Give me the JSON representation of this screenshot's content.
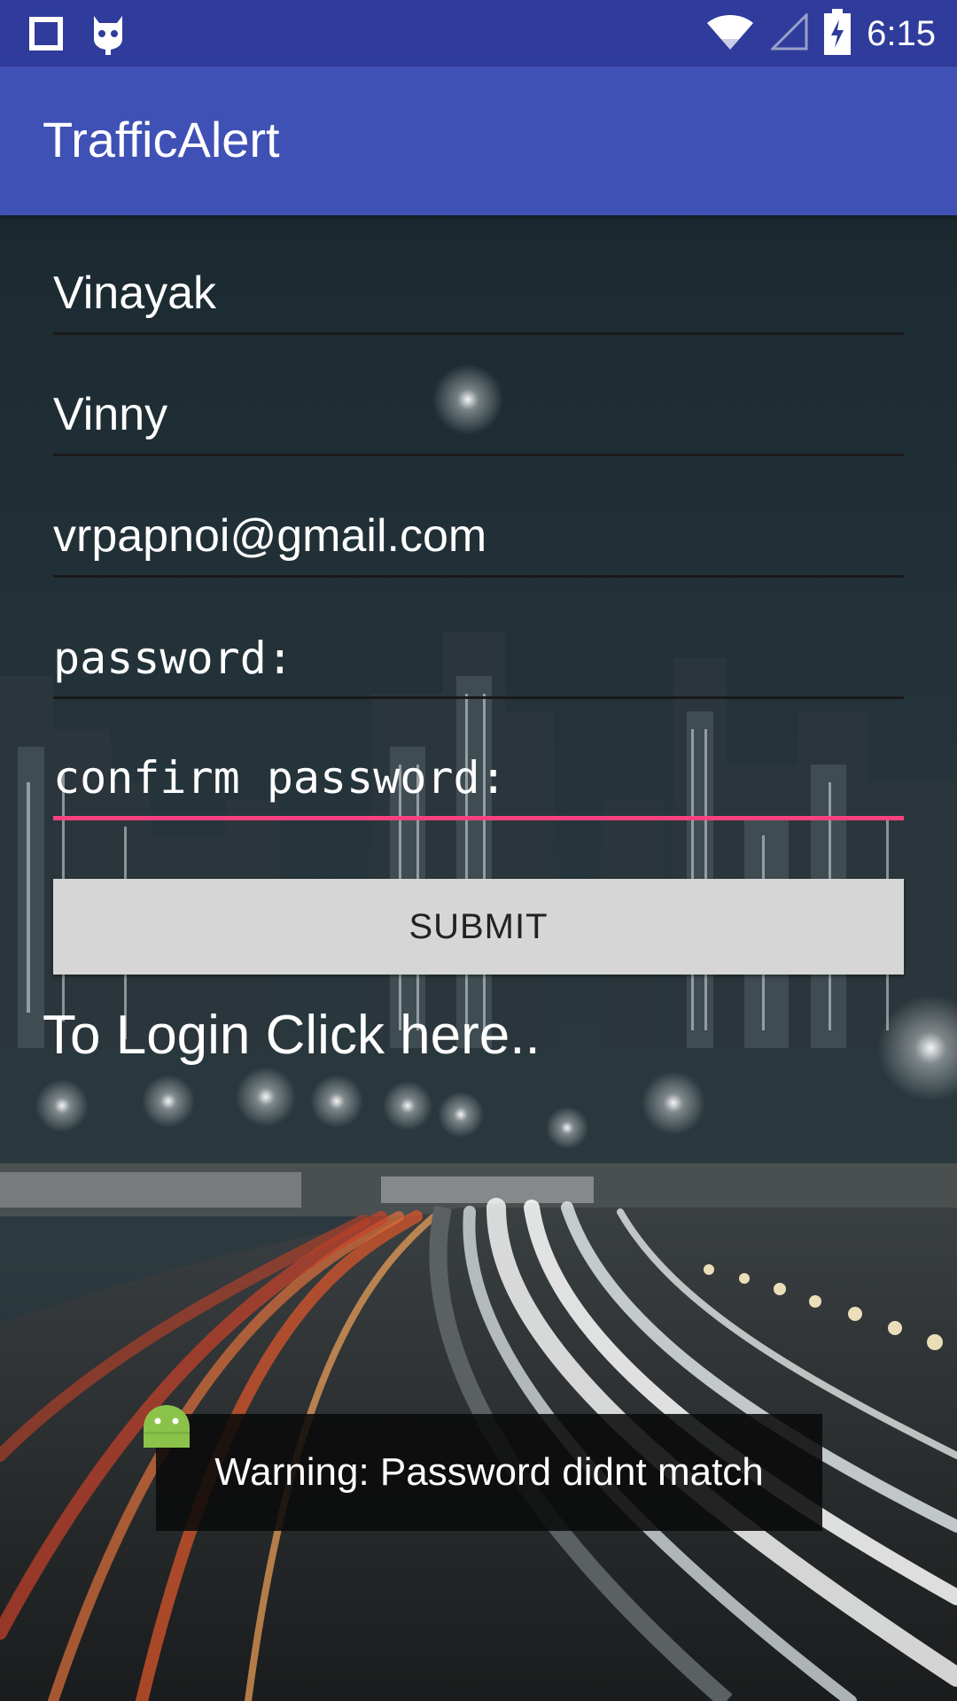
{
  "status_bar": {
    "time": "6:15",
    "icons": [
      "square-icon",
      "cyanogen-icon",
      "wifi-icon",
      "signal-icon",
      "battery-charging-icon"
    ]
  },
  "app": {
    "title": "TrafficAlert",
    "bar_color": "#3f51b5",
    "status_color": "#2f3c9c",
    "accent_color": "#ff4081"
  },
  "form": {
    "fields": [
      {
        "value": "Vinayak"
      },
      {
        "value": "Vinny"
      },
      {
        "value": "vrpapnoi@gmail.com"
      },
      {
        "placeholder": "password:"
      },
      {
        "placeholder": "confirm password:"
      }
    ],
    "submit_label": "SUBMIT",
    "login_link": "To Login Click here.."
  },
  "toast": {
    "message": "Warning: Password didnt match",
    "icon": "android-icon"
  },
  "background": {
    "icon": "city-night-highway-image"
  }
}
